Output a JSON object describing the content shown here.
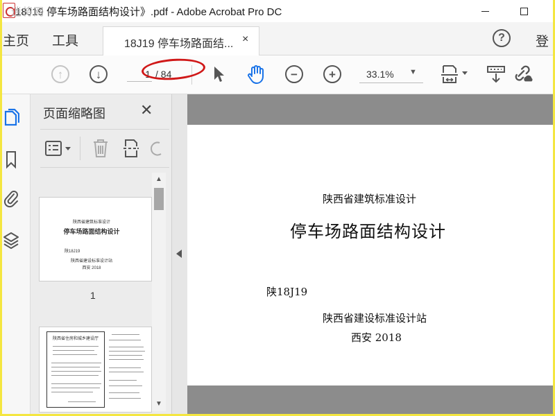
{
  "window": {
    "title": "18J19 停车场路面结构设计》.pdf - Adobe Acrobat Pro DC",
    "watermark": "逍将网"
  },
  "tabs": {
    "home": "主页",
    "tools": "工具",
    "document": "18J19 停车场路面结...",
    "close_glyph": "×",
    "login": "登"
  },
  "toolbar": {
    "page_current": "1",
    "page_total": "/ 84",
    "zoom": "33.1%"
  },
  "thumbnails": {
    "panel_title": "页面缩略图",
    "close_glyph": "✕",
    "page1": {
      "org": "陕西省建筑标准设计",
      "title": "停车场路面结构设计",
      "code": "陕18J19",
      "publisher": "陕西省建设标准设计站",
      "place_year": "西安  2018",
      "number": "1"
    },
    "page2_heading": "陕西省住房和城乡建设厅"
  },
  "document_page": {
    "org": "陕西省建筑标准设计",
    "title": "停车场路面结构设计",
    "code": "陕18J19",
    "publisher": "陕西省建设标准设计站",
    "place_year": "西安  2018"
  },
  "colors": {
    "frame": "#f4e640",
    "annotation": "#d01818",
    "hand_tool": "#1a73e8"
  }
}
